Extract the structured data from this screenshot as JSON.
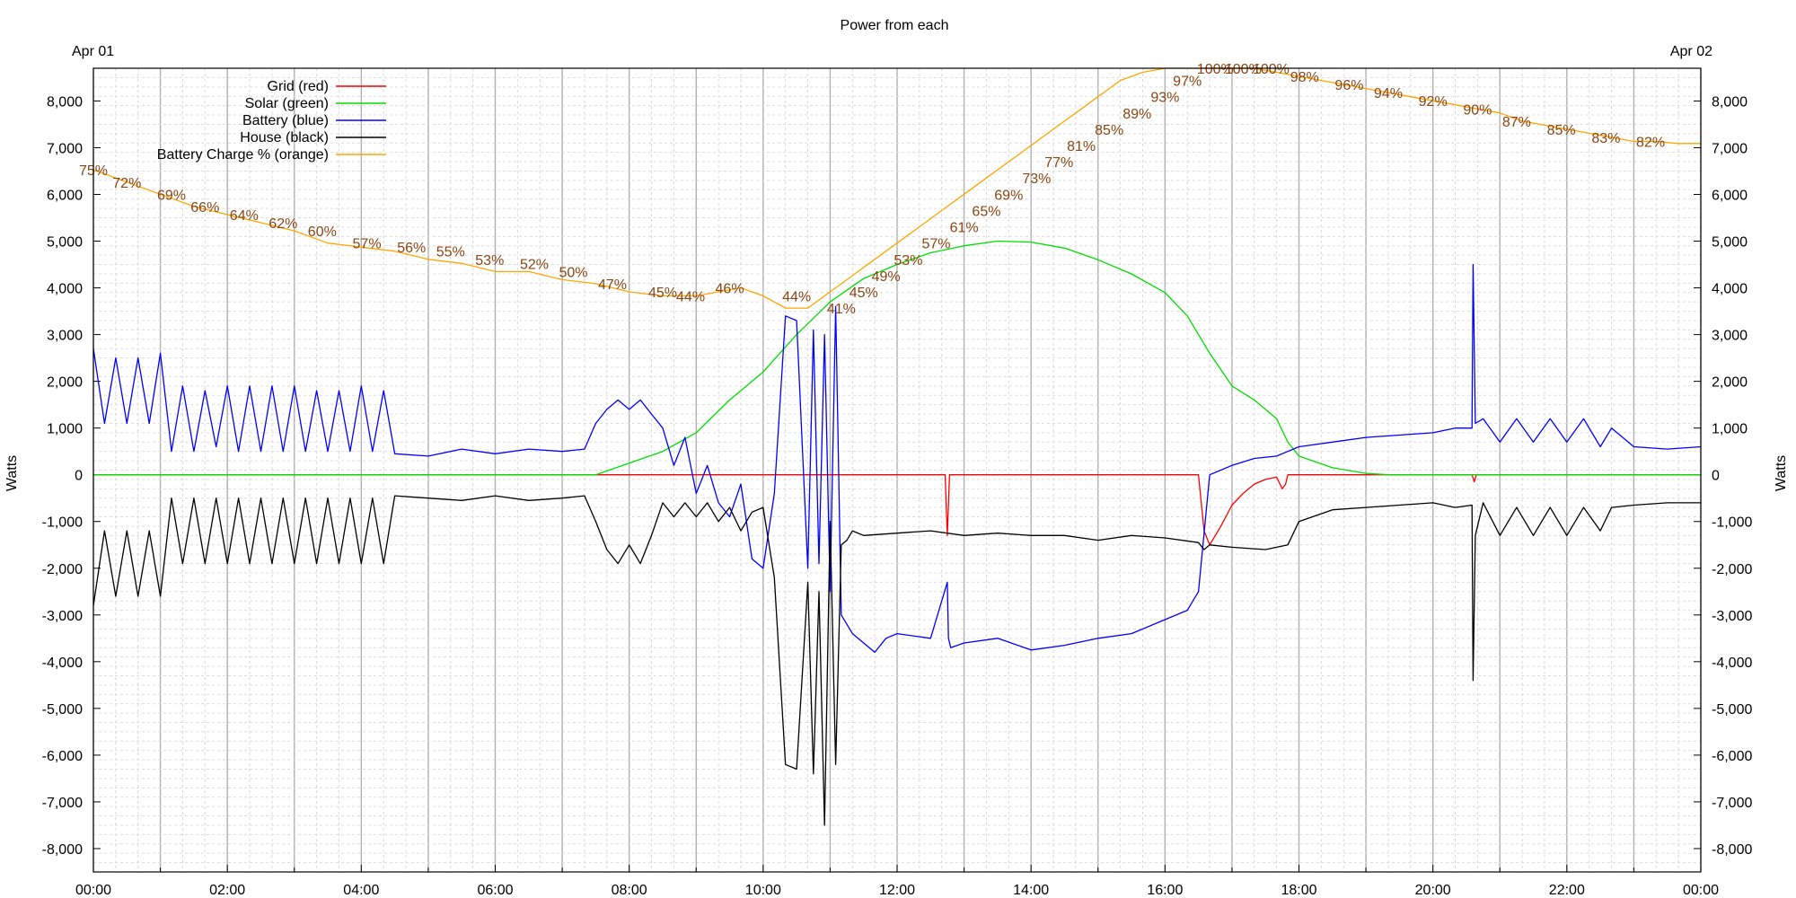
{
  "chart_data": {
    "type": "line",
    "title": "Power from each",
    "date_start_label": "Apr 01",
    "date_end_label": "Apr 02",
    "ylabel": "Watts",
    "xlim": [
      "00:00",
      "24:00"
    ],
    "ylim": [
      -8500,
      8700
    ],
    "grid": true,
    "legend_position": "top-left",
    "x_tick_labels": [
      "00:00",
      "02:00",
      "04:00",
      "06:00",
      "08:00",
      "10:00",
      "12:00",
      "14:00",
      "16:00",
      "18:00",
      "20:00",
      "22:00",
      "00:00"
    ],
    "y_ticks": [
      8000,
      7000,
      6000,
      5000,
      4000,
      3000,
      2000,
      1000,
      0,
      -1000,
      -2000,
      -3000,
      -4000,
      -5000,
      -6000,
      -7000,
      -8000
    ],
    "y_tick_labels": [
      "8,000",
      "7,000",
      "6,000",
      "5,000",
      "4,000",
      "3,000",
      "2,000",
      "1,000",
      "0",
      "-1,000",
      "-2,000",
      "-3,000",
      "-4,000",
      "-5,000",
      "-6,000",
      "-7,000",
      "-8,000"
    ],
    "colors": {
      "grid_series": "#ff0000",
      "solar": "#00dd00",
      "battery": "#0000ff",
      "house": "#000000",
      "charge": "#ffa500",
      "charge_label": "#8b4513"
    },
    "series": [
      {
        "name": "Grid (red)",
        "color": "#ff0000",
        "x": [
          "00:00",
          "08:00",
          "12:43",
          "12:45",
          "12:47",
          "16:30",
          "16:35",
          "16:40",
          "16:50",
          "17:00",
          "17:10",
          "17:20",
          "17:30",
          "17:40",
          "17:45",
          "17:48",
          "17:50",
          "18:00",
          "20:00",
          "20:35",
          "20:37",
          "20:39",
          "24:00"
        ],
        "y": [
          0,
          0,
          0,
          -1300,
          0,
          0,
          -1200,
          -1500,
          -1100,
          -650,
          -400,
          -200,
          -100,
          -50,
          -300,
          -200,
          0,
          0,
          0,
          0,
          -150,
          0,
          0
        ]
      },
      {
        "name": "Solar (green)",
        "color": "#00dd00",
        "x": [
          "00:00",
          "07:20",
          "07:30",
          "08:00",
          "08:30",
          "09:00",
          "09:30",
          "10:00",
          "10:30",
          "11:00",
          "11:30",
          "12:00",
          "12:30",
          "13:00",
          "13:30",
          "14:00",
          "14:30",
          "15:00",
          "15:30",
          "16:00",
          "16:20",
          "16:40",
          "17:00",
          "17:20",
          "17:40",
          "17:50",
          "18:00",
          "18:30",
          "19:00",
          "19:20",
          "19:30",
          "24:00"
        ],
        "y": [
          0,
          0,
          0,
          250,
          500,
          900,
          1600,
          2200,
          3000,
          3700,
          4200,
          4500,
          4750,
          4900,
          5000,
          4980,
          4850,
          4600,
          4300,
          3900,
          3400,
          2600,
          1900,
          1600,
          1200,
          700,
          400,
          150,
          30,
          0,
          0,
          0
        ]
      },
      {
        "name": "Battery (blue)",
        "color": "#0000ff",
        "x": [
          "00:00",
          "00:10",
          "00:20",
          "00:30",
          "00:40",
          "00:50",
          "01:00",
          "01:10",
          "01:20",
          "01:30",
          "01:40",
          "01:50",
          "02:00",
          "02:10",
          "02:20",
          "02:30",
          "02:40",
          "02:50",
          "03:00",
          "03:10",
          "03:20",
          "03:30",
          "03:40",
          "03:50",
          "04:00",
          "04:10",
          "04:20",
          "04:30",
          "05:00",
          "05:30",
          "06:00",
          "06:30",
          "07:00",
          "07:20",
          "07:30",
          "07:40",
          "07:50",
          "08:00",
          "08:10",
          "08:20",
          "08:30",
          "08:40",
          "08:50",
          "09:00",
          "09:10",
          "09:20",
          "09:30",
          "09:40",
          "09:50",
          "10:00",
          "10:10",
          "10:20",
          "10:30",
          "10:40",
          "10:45",
          "10:50",
          "10:55",
          "11:00",
          "11:05",
          "11:10",
          "11:20",
          "11:30",
          "11:40",
          "11:50",
          "12:00",
          "12:30",
          "12:45",
          "12:46",
          "12:48",
          "13:00",
          "13:30",
          "14:00",
          "14:30",
          "15:00",
          "15:30",
          "16:00",
          "16:20",
          "16:30",
          "16:32",
          "16:40",
          "16:50",
          "17:00",
          "17:20",
          "17:40",
          "17:50",
          "18:00",
          "18:30",
          "19:00",
          "19:30",
          "20:00",
          "20:20",
          "20:35",
          "20:36",
          "20:38",
          "20:45",
          "21:00",
          "21:15",
          "21:30",
          "21:45",
          "22:00",
          "22:15",
          "22:30",
          "22:40",
          "23:00",
          "23:30",
          "24:00"
        ],
        "y": [
          2700,
          1100,
          2500,
          1100,
          2500,
          1100,
          2600,
          500,
          1900,
          500,
          1800,
          600,
          1900,
          500,
          1900,
          500,
          1900,
          500,
          1900,
          500,
          1800,
          500,
          1800,
          500,
          1900,
          500,
          1800,
          450,
          400,
          550,
          450,
          550,
          500,
          550,
          1100,
          1400,
          1600,
          1400,
          1600,
          1300,
          1000,
          200,
          800,
          -400,
          200,
          -600,
          -900,
          -200,
          -1800,
          -2000,
          -400,
          3400,
          3300,
          -2000,
          3100,
          -1900,
          3000,
          -2500,
          3600,
          -3000,
          -3400,
          -3600,
          -3800,
          -3500,
          -3400,
          -3500,
          -2300,
          -3500,
          -3700,
          -3600,
          -3500,
          -3750,
          -3650,
          -3500,
          -3400,
          -3100,
          -2900,
          -2500,
          -2000,
          0,
          100,
          200,
          350,
          400,
          500,
          600,
          700,
          800,
          850,
          900,
          1000,
          1000,
          4500,
          1100,
          1200,
          700,
          1200,
          700,
          1200,
          700,
          1200,
          600,
          1000,
          600,
          550,
          600
        ]
      },
      {
        "name": "House (black)",
        "color": "#000000",
        "x": [
          "00:00",
          "00:10",
          "00:20",
          "00:30",
          "00:40",
          "00:50",
          "01:00",
          "01:10",
          "01:20",
          "01:30",
          "01:40",
          "01:50",
          "02:00",
          "02:10",
          "02:20",
          "02:30",
          "02:40",
          "02:50",
          "03:00",
          "03:10",
          "03:20",
          "03:30",
          "03:40",
          "03:50",
          "04:00",
          "04:10",
          "04:20",
          "04:30",
          "05:00",
          "05:30",
          "06:00",
          "06:30",
          "07:00",
          "07:20",
          "07:30",
          "07:40",
          "07:50",
          "08:00",
          "08:10",
          "08:20",
          "08:30",
          "08:40",
          "08:50",
          "09:00",
          "09:10",
          "09:20",
          "09:30",
          "09:40",
          "09:50",
          "10:00",
          "10:10",
          "10:20",
          "10:30",
          "10:40",
          "10:45",
          "10:50",
          "10:55",
          "11:00",
          "11:05",
          "11:10",
          "11:15",
          "11:20",
          "11:30",
          "12:00",
          "12:30",
          "13:00",
          "13:30",
          "14:00",
          "14:30",
          "15:00",
          "15:30",
          "16:00",
          "16:30",
          "16:35",
          "16:40",
          "17:00",
          "17:30",
          "17:50",
          "18:00",
          "18:30",
          "19:00",
          "19:30",
          "20:00",
          "20:20",
          "20:35",
          "20:36",
          "20:38",
          "20:45",
          "21:00",
          "21:15",
          "21:30",
          "21:45",
          "22:00",
          "22:15",
          "22:30",
          "22:40",
          "23:00",
          "23:30",
          "24:00"
        ],
        "y": [
          -2800,
          -1200,
          -2600,
          -1200,
          -2600,
          -1200,
          -2600,
          -500,
          -1900,
          -500,
          -1900,
          -500,
          -1900,
          -500,
          -1900,
          -500,
          -1900,
          -500,
          -1900,
          -500,
          -1900,
          -500,
          -1900,
          -500,
          -1900,
          -500,
          -1900,
          -450,
          -500,
          -550,
          -450,
          -550,
          -500,
          -450,
          -1000,
          -1600,
          -1900,
          -1500,
          -1900,
          -1300,
          -600,
          -900,
          -600,
          -900,
          -600,
          -1000,
          -700,
          -1200,
          -800,
          -700,
          -2200,
          -6200,
          -6300,
          -2300,
          -6400,
          -2500,
          -7500,
          -1000,
          -6200,
          -1500,
          -1400,
          -1200,
          -1300,
          -1250,
          -1200,
          -1300,
          -1250,
          -1300,
          -1300,
          -1400,
          -1300,
          -1350,
          -1450,
          -1600,
          -1500,
          -1550,
          -1600,
          -1500,
          -1000,
          -750,
          -700,
          -650,
          -600,
          -700,
          -650,
          -4400,
          -1300,
          -600,
          -1300,
          -700,
          -1300,
          -700,
          -1300,
          -700,
          -1200,
          -700,
          -650,
          -600,
          -600
        ]
      },
      {
        "name": "Battery Charge % (orange)",
        "color": "#ffa500",
        "x": [
          "00:00",
          "00:30",
          "01:00",
          "01:30",
          "02:00",
          "02:30",
          "03:00",
          "03:30",
          "04:00",
          "04:30",
          "05:00",
          "05:30",
          "06:00",
          "06:30",
          "07:00",
          "07:30",
          "08:00",
          "08:30",
          "09:00",
          "09:20",
          "09:40",
          "10:00",
          "10:20",
          "10:40",
          "11:00",
          "11:20",
          "11:40",
          "12:00",
          "12:20",
          "12:40",
          "13:00",
          "13:20",
          "13:40",
          "14:00",
          "14:20",
          "14:40",
          "15:00",
          "15:20",
          "15:40",
          "16:00",
          "16:20",
          "16:40",
          "17:00",
          "17:20",
          "17:40",
          "18:00",
          "18:20",
          "18:40",
          "19:00",
          "19:20",
          "19:40",
          "20:00",
          "20:20",
          "20:40",
          "21:00",
          "21:20",
          "21:40",
          "22:00",
          "22:20",
          "22:40",
          "23:00",
          "23:20",
          "23:40",
          "24:00"
        ],
        "y": [
          75,
          72,
          69,
          66,
          64,
          62,
          60,
          57,
          56,
          55,
          53,
          52,
          50,
          50,
          48,
          47,
          45,
          44,
          44,
          45,
          46,
          44,
          41,
          41,
          45,
          49,
          53,
          57,
          61,
          65,
          69,
          73,
          77,
          81,
          85,
          89,
          93,
          97,
          99,
          100,
          100,
          100,
          100,
          100,
          99,
          98,
          97,
          96,
          95,
          94,
          93,
          92,
          91,
          90,
          89,
          87,
          86,
          85,
          84,
          83,
          82,
          82,
          81.5,
          81.5
        ]
      }
    ],
    "charge_axis": {
      "pct_min": 0,
      "pct_max": 100,
      "maps_to_watts": [
        0,
        8700
      ]
    },
    "annotations": [
      "75%",
      "72%",
      "69%",
      "66%",
      "64%",
      "62%",
      "60%",
      "57%",
      "56%",
      "55%",
      "53%",
      "52%",
      "50%",
      "47%",
      "45%",
      "44%",
      "46%",
      "44%",
      "41%",
      "45%",
      "49%",
      "53%",
      "57%",
      "61%",
      "65%",
      "69%",
      "73%",
      "77%",
      "81%",
      "85%",
      "89%",
      "93%",
      "97%",
      "100%",
      "100%",
      "100%",
      "98%",
      "96%",
      "94%",
      "92%",
      "90%",
      "87%",
      "85%",
      "83%",
      "82%"
    ],
    "annotation_times": [
      "00:00",
      "00:30",
      "01:10",
      "01:40",
      "02:15",
      "02:50",
      "03:25",
      "04:05",
      "04:45",
      "05:20",
      "05:55",
      "06:35",
      "07:10",
      "07:45",
      "08:30",
      "08:55",
      "09:30",
      "10:30",
      "11:10",
      "11:30",
      "11:50",
      "12:10",
      "12:35",
      "13:00",
      "13:20",
      "13:40",
      "14:05",
      "14:25",
      "14:45",
      "15:10",
      "15:35",
      "16:00",
      "16:20",
      "16:45",
      "17:10",
      "17:35",
      "18:05",
      "18:45",
      "19:20",
      "20:00",
      "20:40",
      "21:15",
      "21:55",
      "22:35",
      "23:15"
    ],
    "annotation_values": [
      75,
      72,
      69,
      66,
      64,
      62,
      60,
      57,
      56,
      55,
      53,
      52,
      50,
      47,
      45,
      44,
      46,
      44,
      41,
      45,
      49,
      53,
      57,
      61,
      65,
      69,
      73,
      77,
      81,
      85,
      89,
      93,
      97,
      100,
      100,
      100,
      98,
      96,
      94,
      92,
      90,
      87,
      85,
      83,
      82
    ]
  }
}
